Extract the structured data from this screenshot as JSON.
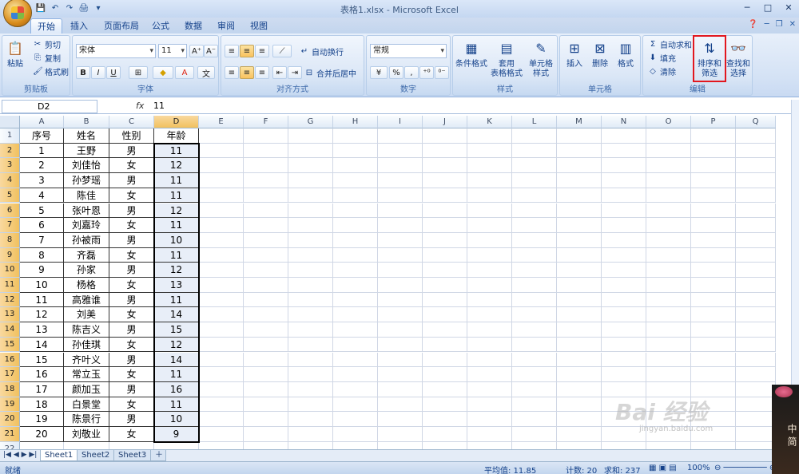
{
  "title": "表格1.xlsx - Microsoft Excel",
  "tabs": [
    "开始",
    "插入",
    "页面布局",
    "公式",
    "数据",
    "审阅",
    "视图"
  ],
  "clipboard": {
    "paste": "粘贴",
    "cut": "剪切",
    "copy": "复制",
    "format_painter": "格式刷",
    "label": "剪贴板"
  },
  "font": {
    "name": "宋体",
    "size": "11",
    "label": "字体"
  },
  "alignment": {
    "wrap": "自动换行",
    "merge": "合并后居中",
    "label": "对齐方式"
  },
  "number": {
    "format": "常规",
    "label": "数字"
  },
  "styles": {
    "conditional": "条件格式",
    "table_format": "套用\n表格格式",
    "cell_style": "单元格\n样式",
    "label": "样式"
  },
  "cells": {
    "insert": "插入",
    "delete": "删除",
    "format": "格式",
    "label": "单元格"
  },
  "editing": {
    "autosum": "自动求和",
    "fill": "填充",
    "clear": "清除",
    "sort": "排序和\n筛选",
    "find": "查找和\n选择",
    "label": "编辑"
  },
  "formula": {
    "name_box": "D2",
    "fx": "fx",
    "value": "11"
  },
  "columns": [
    "A",
    "B",
    "C",
    "D",
    "E",
    "F",
    "G",
    "H",
    "I",
    "J",
    "K",
    "L",
    "M",
    "N",
    "O",
    "P",
    "Q"
  ],
  "header_row": [
    "序号",
    "姓名",
    "性别",
    "年龄"
  ],
  "rows": [
    [
      "1",
      "王野",
      "男",
      "11"
    ],
    [
      "2",
      "刘佳怡",
      "女",
      "12"
    ],
    [
      "3",
      "孙梦瑶",
      "男",
      "11"
    ],
    [
      "4",
      "陈佳",
      "女",
      "11"
    ],
    [
      "5",
      "张叶恩",
      "男",
      "12"
    ],
    [
      "6",
      "刘嘉玲",
      "女",
      "11"
    ],
    [
      "7",
      "孙被雨",
      "男",
      "10"
    ],
    [
      "8",
      "齐磊",
      "女",
      "11"
    ],
    [
      "9",
      "孙家",
      "男",
      "12"
    ],
    [
      "10",
      "杨格",
      "女",
      "13"
    ],
    [
      "11",
      "高雅谁",
      "男",
      "11"
    ],
    [
      "12",
      "刘美",
      "女",
      "14"
    ],
    [
      "13",
      "陈吉义",
      "男",
      "15"
    ],
    [
      "14",
      "孙佳琪",
      "女",
      "12"
    ],
    [
      "15",
      "齐叶义",
      "男",
      "14"
    ],
    [
      "16",
      "常立玉",
      "女",
      "11"
    ],
    [
      "17",
      "颜加玉",
      "男",
      "16"
    ],
    [
      "18",
      "白景堂",
      "女",
      "11"
    ],
    [
      "19",
      "陈景行",
      "男",
      "10"
    ],
    [
      "20",
      "刘敬业",
      "女",
      "9"
    ]
  ],
  "sheets": [
    "Sheet1",
    "Sheet2",
    "Sheet3"
  ],
  "status": {
    "ready": "就绪",
    "average": "平均值: 11.85",
    "count": "计数: 20",
    "sum": "求和: 237",
    "zoom": "100%"
  },
  "watermark": {
    "text": "Bai 经验",
    "sub": "jingyan.baidu.com"
  },
  "decor_text": "中 简"
}
